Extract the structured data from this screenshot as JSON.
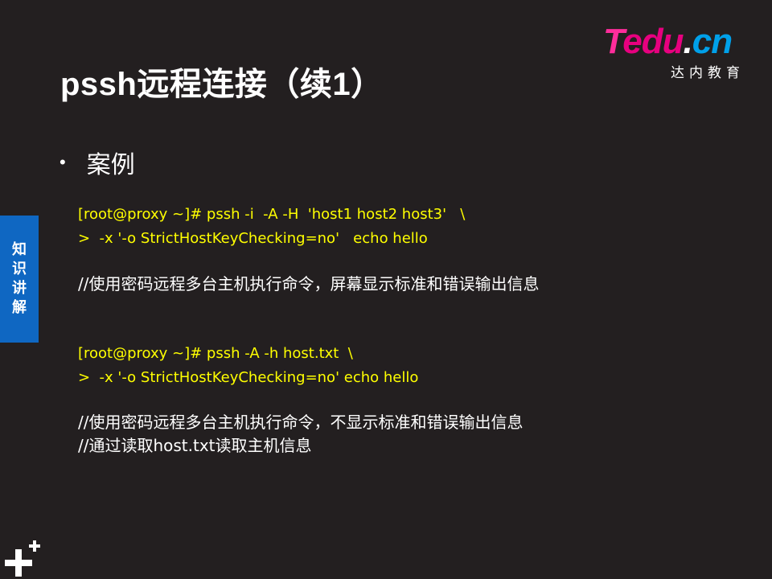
{
  "title": "pssh远程连接（续1）",
  "logo": {
    "word_t": "T",
    "word_edu": "edu",
    "word_dot": ".",
    "word_cn": "cn",
    "subtitle": "达内教育"
  },
  "side_tab": {
    "chars": [
      "知",
      "识",
      "讲",
      "解"
    ]
  },
  "bullet": {
    "symbol": "•",
    "label": "案例"
  },
  "example1": {
    "cmd_line1": "[root@proxy ~]# pssh -i  -A -H  'host1 host2 host3'   \\",
    "cmd_line2": ">  -x '-o StrictHostKeyChecking=no'   echo hello",
    "note": "//使用密码远程多台主机执行命令，屏幕显示标准和错误输出信息"
  },
  "example2": {
    "cmd_line1": "[root@proxy ~]# pssh -A -h host.txt  \\",
    "cmd_line2": ">  -x '-o StrictHostKeyChecking=no' echo hello",
    "note_line1": "//使用密码远程多台主机执行命令，不显示标准和错误输出信息",
    "note_line2": "//通过读取host.txt读取主机信息"
  },
  "colors": {
    "background": "#231f20",
    "command": "#ffff00",
    "side_tab": "#0f67c2",
    "logo_pink": "#e7007f",
    "logo_blue": "#00a0e9"
  },
  "icons": {
    "corner": "plus-marks-icon"
  }
}
